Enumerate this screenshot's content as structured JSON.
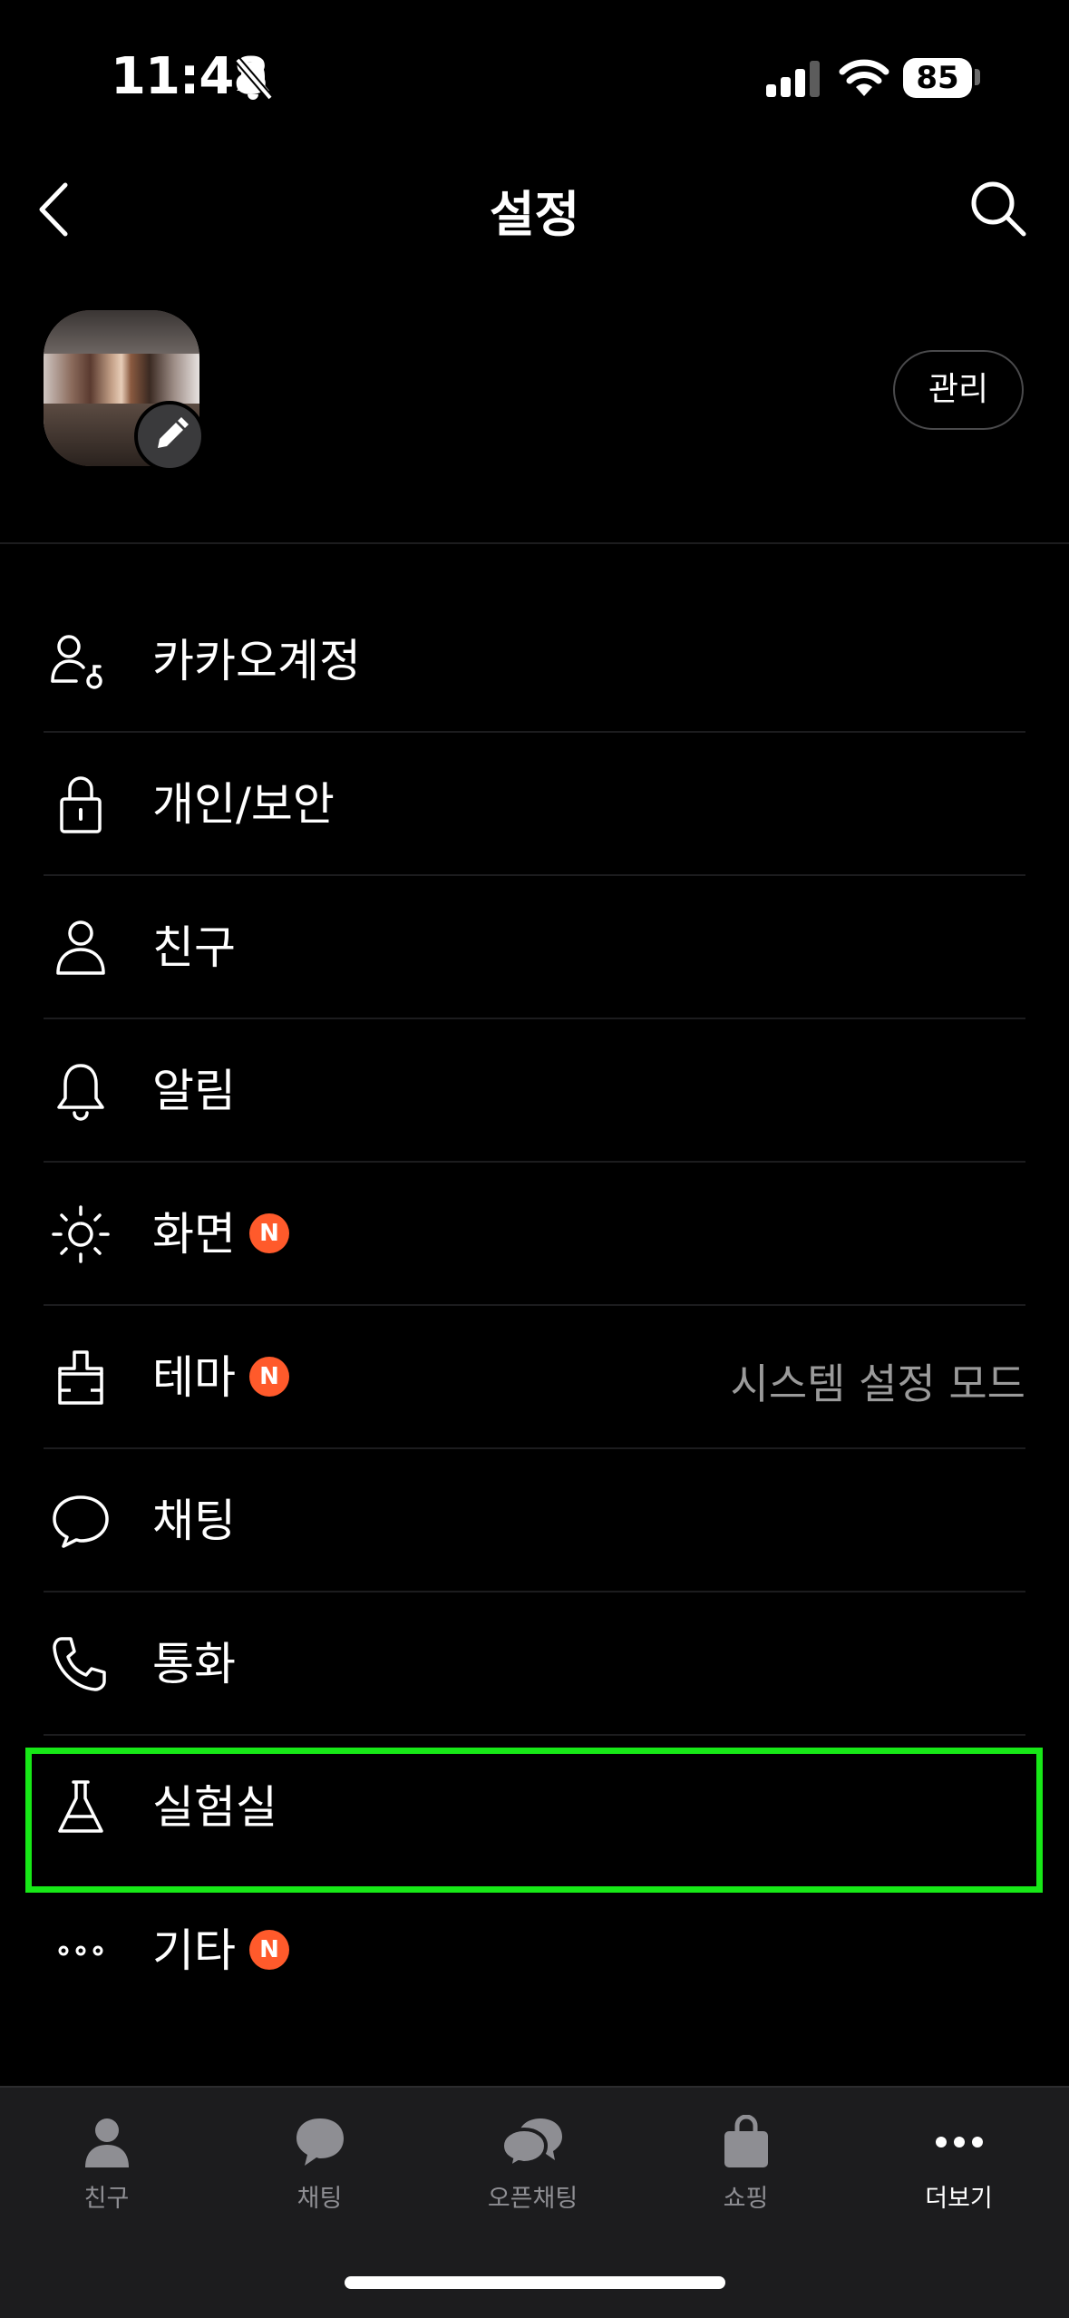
{
  "status_bar": {
    "time": "11:48",
    "battery": "85"
  },
  "header": {
    "title": "설정"
  },
  "profile": {
    "manage_label": "관리"
  },
  "menu": {
    "items": [
      {
        "label": "카카오계정",
        "icon": "account-icon"
      },
      {
        "label": "개인/보안",
        "icon": "lock-icon"
      },
      {
        "label": "친구",
        "icon": "person-icon"
      },
      {
        "label": "알림",
        "icon": "bell-icon"
      },
      {
        "label": "화면",
        "icon": "brightness-icon",
        "badge": "N"
      },
      {
        "label": "테마",
        "icon": "brush-icon",
        "badge": "N",
        "value": "시스템 설정 모드"
      },
      {
        "label": "채팅",
        "icon": "chat-bubble-icon"
      },
      {
        "label": "통화",
        "icon": "phone-icon"
      },
      {
        "label": "실험실",
        "icon": "flask-icon"
      },
      {
        "label": "기타",
        "icon": "more-dots-icon",
        "badge": "N"
      }
    ]
  },
  "tabs": [
    {
      "label": "친구",
      "icon": "person-filled-icon",
      "active": false
    },
    {
      "label": "채팅",
      "icon": "chat-filled-icon",
      "active": false
    },
    {
      "label": "오픈채팅",
      "icon": "open-chat-icon",
      "active": false
    },
    {
      "label": "쇼핑",
      "icon": "shopping-bag-icon",
      "active": false
    },
    {
      "label": "더보기",
      "icon": "more-icon",
      "active": true
    }
  ],
  "colors": {
    "background": "#000000",
    "badge": "#ff5a2b",
    "highlight": "#17e817",
    "tab_bar": "#1c1c1e"
  }
}
